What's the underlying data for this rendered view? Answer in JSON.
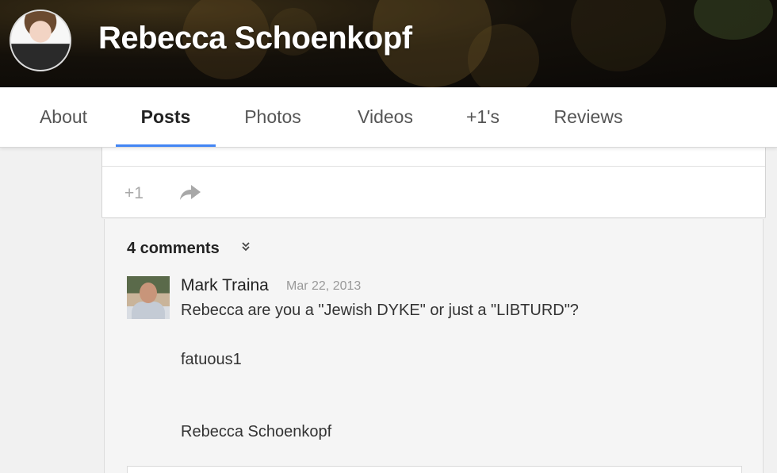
{
  "header": {
    "profile_name": "Rebecca Schoenkopf"
  },
  "tabs": [
    {
      "label": "About"
    },
    {
      "label": "Posts",
      "active": true
    },
    {
      "label": "Photos"
    },
    {
      "label": "Videos"
    },
    {
      "label": "+1's"
    },
    {
      "label": "Reviews"
    }
  ],
  "post_actions": {
    "plusone_label": "+1",
    "share_icon": "share-arrow-icon"
  },
  "comments": {
    "count_label": "4 comments",
    "expand_icon": "chevron-double-down-icon",
    "items": [
      {
        "author": "Mark Traina",
        "date": "Mar 22, 2013",
        "lines": [
          "Rebecca are you a \"Jewish DYKE\" or just a \"LIBTURD\"?",
          "fatuous1",
          "Rebecca Schoenkopf"
        ]
      }
    ]
  },
  "colors": {
    "accent": "#4285f4",
    "banner_dark": "#14100a",
    "tab_text": "#555555",
    "tab_active_text": "#222222",
    "comments_bg": "#f5f5f5"
  }
}
